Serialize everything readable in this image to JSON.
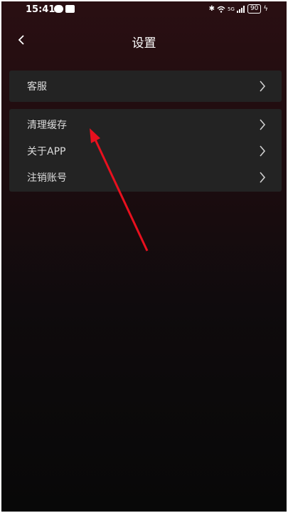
{
  "status_bar": {
    "time": "15:41",
    "network": "5G",
    "battery": "90"
  },
  "header": {
    "title": "设置"
  },
  "menu": {
    "group1": [
      {
        "label": "客服"
      }
    ],
    "group2": [
      {
        "label": "清理缓存"
      },
      {
        "label": "关于APP"
      },
      {
        "label": "注销账号"
      }
    ]
  },
  "colors": {
    "card_bg": "#232323",
    "accent_arrow": "#e8101e",
    "background_top": "#2a0f12"
  }
}
